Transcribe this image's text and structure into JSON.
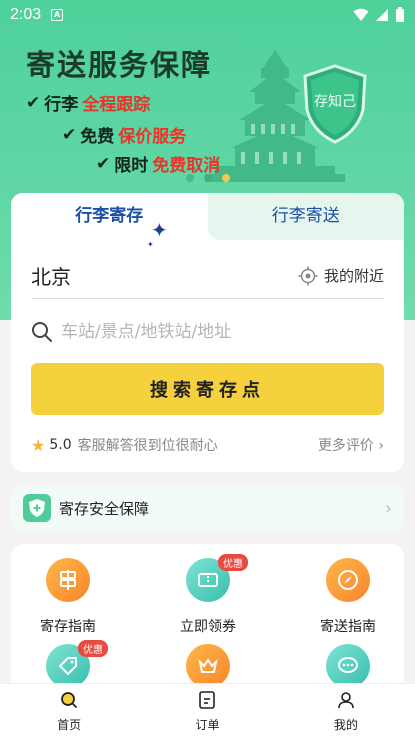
{
  "status_bar": {
    "time": "2:03",
    "notification_glyph": "A"
  },
  "banner": {
    "title": "寄送服务保障",
    "slogans": [
      {
        "prefix": "行李",
        "highlight": "全程跟踪"
      },
      {
        "prefix": "免费",
        "highlight": "保价服务"
      },
      {
        "prefix": "限时",
        "highlight": "免费取消"
      }
    ],
    "shield_text": "存知己",
    "carousel_pages": 3,
    "carousel_active": 3,
    "colors": {
      "bg": "#5fd6a4",
      "highlight": "#e8352b"
    }
  },
  "tabs": [
    {
      "label": "行李寄存",
      "active": true
    },
    {
      "label": "行李寄送",
      "active": false
    }
  ],
  "search": {
    "city": "北京",
    "nearby_label": "我的附近",
    "placeholder": "车站/景点/地铁站/地址",
    "button_label": "搜索寄存点"
  },
  "rating": {
    "score": "5.0",
    "review": "客服解答很到位很耐心",
    "more_label": "更多评价"
  },
  "safety": {
    "label": "寄存安全保障"
  },
  "services": [
    {
      "label": "寄存指南",
      "badge": "",
      "color": "orange",
      "icon": "signpost-icon"
    },
    {
      "label": "立即领券",
      "badge": "优惠",
      "color": "teal",
      "icon": "ticket-icon"
    },
    {
      "label": "寄送指南",
      "badge": "",
      "color": "orange",
      "icon": "compass-icon"
    },
    {
      "label": "",
      "badge": "优惠",
      "color": "teal",
      "icon": "tag-icon"
    },
    {
      "label": "",
      "badge": "",
      "color": "orange",
      "icon": "crown-icon"
    },
    {
      "label": "",
      "badge": "",
      "color": "teal",
      "icon": "chat-icon"
    }
  ],
  "bottom_nav": [
    {
      "label": "首页",
      "icon": "home-search-icon",
      "active": true
    },
    {
      "label": "订单",
      "icon": "order-icon",
      "active": false
    },
    {
      "label": "我的",
      "icon": "profile-icon",
      "active": false
    }
  ]
}
